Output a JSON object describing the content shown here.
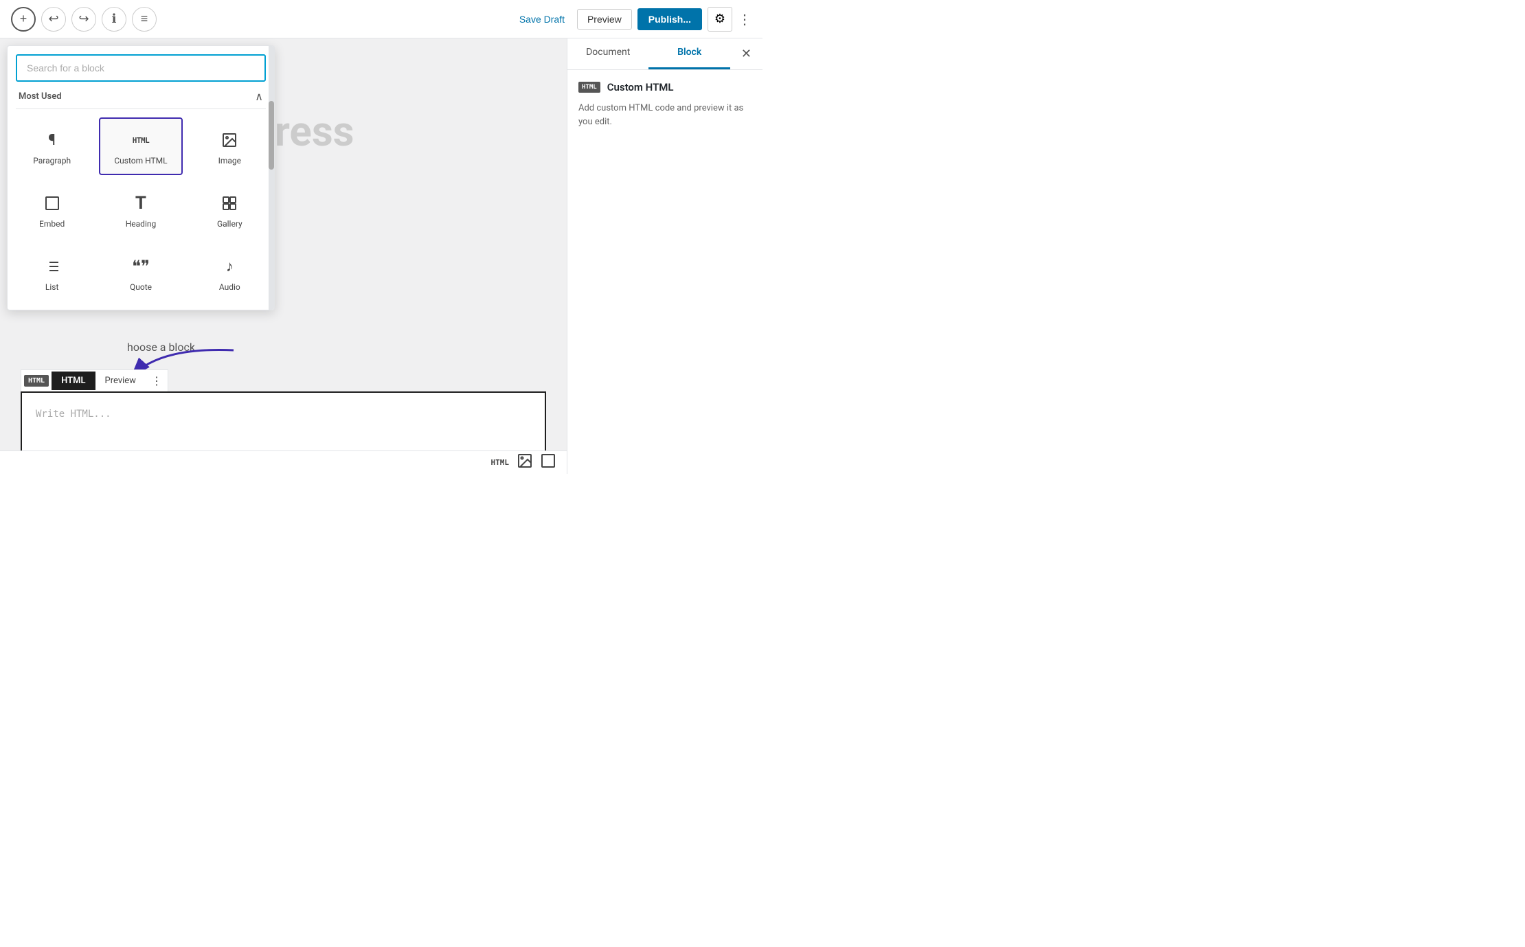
{
  "toolbar": {
    "save_draft_label": "Save Draft",
    "preview_label": "Preview",
    "publish_label": "Publish...",
    "add_icon": "+",
    "undo_icon": "↩",
    "redo_icon": "↪",
    "info_icon": "ℹ",
    "list_icon": "≡",
    "settings_icon": "⚙",
    "more_icon": "⋮"
  },
  "block_picker": {
    "search_placeholder": "Search for a block",
    "section_title": "Most Used",
    "blocks": [
      {
        "id": "paragraph",
        "label": "Paragraph",
        "icon": "¶"
      },
      {
        "id": "custom-html",
        "label": "Custom HTML",
        "icon": "HTML",
        "selected": true
      },
      {
        "id": "image",
        "label": "Image",
        "icon": "🖼"
      },
      {
        "id": "embed",
        "label": "Embed",
        "icon": "□"
      },
      {
        "id": "heading",
        "label": "Heading",
        "icon": "T"
      },
      {
        "id": "gallery",
        "label": "Gallery",
        "icon": "⊞"
      },
      {
        "id": "list",
        "label": "List",
        "icon": "≡"
      },
      {
        "id": "quote",
        "label": "Quote",
        "icon": "❝"
      },
      {
        "id": "audio",
        "label": "Audio",
        "icon": "♪"
      }
    ]
  },
  "editor": {
    "large_text": "ress",
    "choose_block_text": "hoose a block"
  },
  "html_block": {
    "badge_label": "HTML",
    "tab_html": "HTML",
    "tab_preview": "Preview",
    "placeholder": "Write HTML..."
  },
  "bottom_bar": {
    "html_label": "HTML"
  },
  "right_panel": {
    "tab_document": "Document",
    "tab_block": "Block",
    "block_badge": "HTML",
    "block_name": "Custom HTML",
    "block_description": "Add custom HTML code and preview it as you edit."
  }
}
